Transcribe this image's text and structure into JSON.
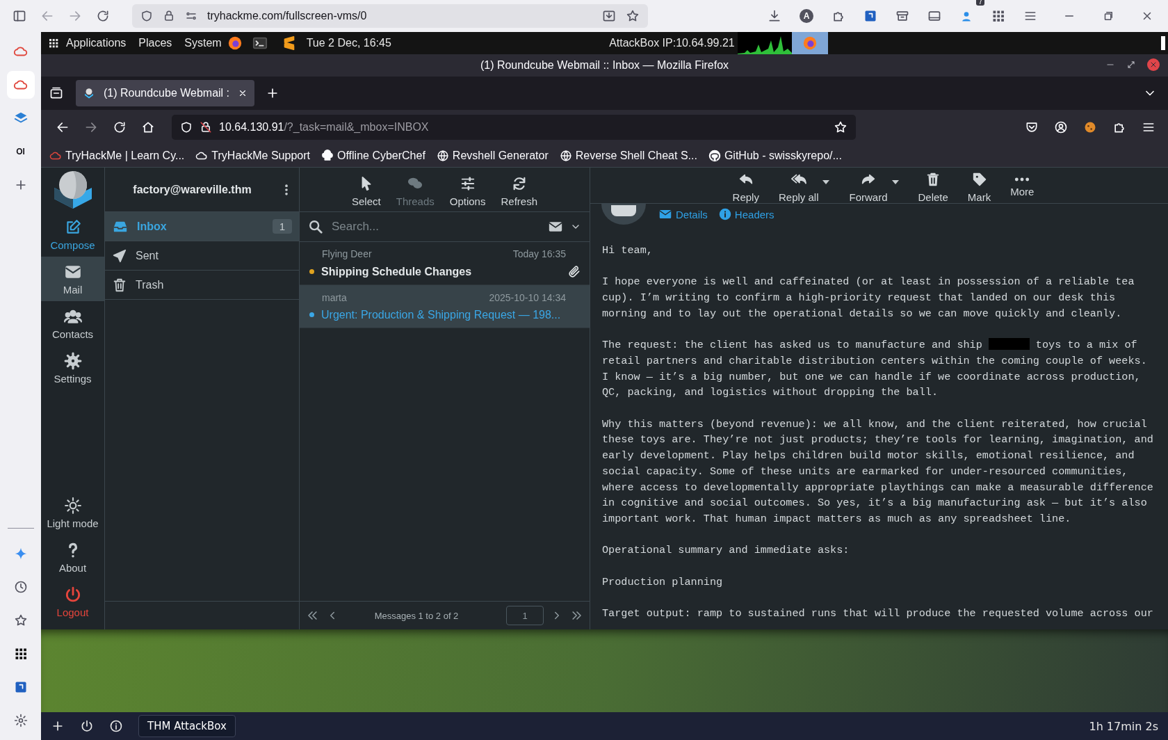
{
  "browser": {
    "url": "tryhackme.com/fullscreen-vms/0",
    "avatar": "A",
    "badge": "7",
    "sidebar_label": "OI"
  },
  "desktop_panel": {
    "menus": [
      "Applications",
      "Places",
      "System"
    ],
    "clock": "Tue 2 Dec, 16:45",
    "ip": "AttackBox IP:10.64.99.21"
  },
  "firefox": {
    "title": "(1) Roundcube Webmail :: Inbox — Mozilla Firefox",
    "tab": "(1) Roundcube Webmail :",
    "url_host": "10.64.130.91",
    "url_path": "/?_task=mail&_mbox=INBOX",
    "bookmarks": [
      {
        "label": "TryHackMe | Learn Cy...",
        "kind": "cloud"
      },
      {
        "label": "TryHackMe Support",
        "kind": "cloudgrey"
      },
      {
        "label": "Offline CyberChef",
        "kind": "chef"
      },
      {
        "label": "Revshell Generator",
        "kind": "globe"
      },
      {
        "label": "Reverse Shell Cheat S...",
        "kind": "globe"
      },
      {
        "label": "GitHub - swisskyrepo/...",
        "kind": "github"
      }
    ]
  },
  "roundcube": {
    "nav": {
      "main": [
        {
          "label": "Compose",
          "kind": "compose",
          "selected": false
        },
        {
          "label": "Mail",
          "kind": "mail",
          "selected": true
        },
        {
          "label": "Contacts",
          "kind": "contacts",
          "selected": false
        },
        {
          "label": "Settings",
          "kind": "settings",
          "selected": false
        }
      ],
      "footer": [
        {
          "label": "Light mode",
          "kind": "theme",
          "selected": false
        },
        {
          "label": "About",
          "kind": "about",
          "selected": false
        },
        {
          "label": "Logout",
          "kind": "logout",
          "selected": false
        }
      ]
    },
    "account": "factory@wareville.thm",
    "folders": [
      {
        "name": "Inbox",
        "kind": "inbox",
        "count": "1",
        "selected": true
      },
      {
        "name": "Sent",
        "kind": "sent",
        "selected": false
      },
      {
        "name": "Trash",
        "kind": "trash",
        "selected": false
      }
    ],
    "list_toolbar": [
      {
        "label": "Select",
        "kind": "select",
        "disabled": false
      },
      {
        "label": "Threads",
        "kind": "threads",
        "disabled": true
      },
      {
        "label": "Options",
        "kind": "options",
        "disabled": false
      },
      {
        "label": "Refresh",
        "kind": "refresh",
        "disabled": false
      }
    ],
    "search": {
      "placeholder": "Search..."
    },
    "messages": [
      {
        "from": "Flying Deer",
        "date": "Today 16:35",
        "subject": "Shipping Schedule Changes",
        "unread": true,
        "selected": false,
        "attachment": true,
        "color": "#e0a31f"
      },
      {
        "from": "marta",
        "date": "2025-10-10 14:34",
        "subject": "Urgent: Production & Shipping Request — 198...",
        "unread": false,
        "selected": true,
        "attachment": false,
        "color": "#3aa7e6"
      }
    ],
    "pagination": {
      "summary": "Messages 1 to 2 of 2",
      "page": "1"
    },
    "reader_toolbar": [
      {
        "label": "Reply",
        "kind": "reply",
        "dropdown": false
      },
      {
        "label": "Reply all",
        "kind": "replyall",
        "dropdown": true
      },
      {
        "label": "Forward",
        "kind": "forward",
        "dropdown": true
      },
      {
        "label": "Delete",
        "kind": "delete",
        "dropdown": false
      },
      {
        "label": "Mark",
        "kind": "mark",
        "dropdown": false
      },
      {
        "label": "More",
        "kind": "more",
        "dropdown": false
      }
    ],
    "header_links": [
      {
        "label": "Details",
        "kind": "details"
      },
      {
        "label": "Headers",
        "kind": "headers"
      }
    ],
    "body": [
      [
        "Hi team,"
      ],
      [
        "I hope everyone is well and caffeinated (or at least in possession of a reliable tea",
        "cup). I’m writing to confirm a high-priority request that landed on our desk this",
        "morning and to lay out the operational details so we can move quickly and cleanly."
      ],
      [
        {
          "before": "The request: the client has asked us to manufacture and ship",
          "after": "toys to a mix of",
          "redacted": true
        },
        "retail partners and charitable distribution centers within the coming couple of weeks.",
        "I know — it’s a big number, but one we can handle if we coordinate across production,",
        "QC, packing, and logistics without dropping the ball."
      ],
      [
        "Why this matters (beyond revenue): we all know, and the client reiterated, how crucial",
        "these toys are. They’re not just products; they’re tools for learning, imagination, and",
        "early development. Play helps children build motor skills, emotional resilience, and",
        "social capacity. Some of these units are earmarked for under-resourced communities,",
        "where access to developmentally appropriate playthings can make a measurable difference",
        "in cognitive and social outcomes. So yes, it’s a big manufacturing ask — but it’s also",
        "important work. That human impact matters as much as any spreadsheet line."
      ],
      [
        "Operational summary and immediate asks:"
      ],
      [
        "Production planning"
      ],
      [
        "Target output: ramp to sustained runs that will produce the requested volume across our"
      ]
    ]
  },
  "taskbar": {
    "button": "THM AttackBox",
    "timer": "1h 17min 2s"
  }
}
